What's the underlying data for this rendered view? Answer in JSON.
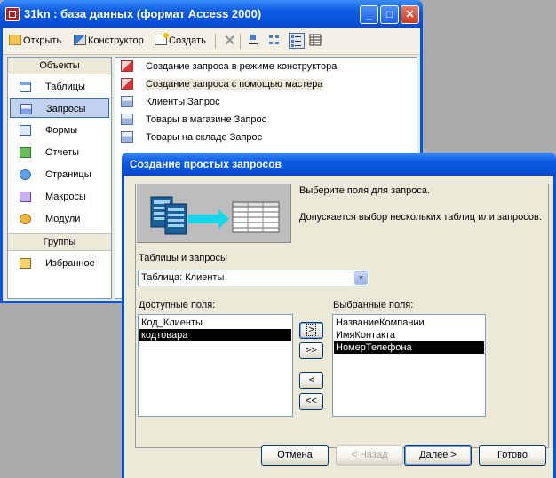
{
  "db_window": {
    "title": "31kn : база данных (формат Access 2000)",
    "title_buttons": {
      "minimize": "_",
      "maximize": "□",
      "close": "✕"
    },
    "toolbar": {
      "open": "Открыть",
      "design": "Конструктор",
      "new": "Создать",
      "delete_icon": "✕"
    },
    "objects_header": "Объекты",
    "objects": [
      {
        "label": "Таблицы",
        "icon": "table-icon"
      },
      {
        "label": "Запросы",
        "icon": "query-icon",
        "selected": true
      },
      {
        "label": "Формы",
        "icon": "form-icon"
      },
      {
        "label": "Отчеты",
        "icon": "report-icon"
      },
      {
        "label": "Страницы",
        "icon": "page-icon"
      },
      {
        "label": "Макросы",
        "icon": "macro-icon"
      },
      {
        "label": "Модули",
        "icon": "module-icon"
      }
    ],
    "groups_header": "Группы",
    "groups": [
      {
        "label": "Избранное",
        "icon": "favorites-icon"
      }
    ],
    "list_items": [
      {
        "label": "Создание запроса в режиме конструктора",
        "icon": "wizard-icon"
      },
      {
        "label": "Создание запроса с помощью мастера",
        "icon": "wizard-icon"
      },
      {
        "label": "Клиенты Запрос",
        "icon": "query-icon"
      },
      {
        "label": "Товары в магазине Запрос",
        "icon": "query-icon"
      },
      {
        "label": "Товары на складе Запрос",
        "icon": "query-icon"
      }
    ]
  },
  "dialog": {
    "title": "Создание простых запросов",
    "instruction": "Выберите поля для запроса.",
    "hint": "Допускается выбор нескольких таблиц или запросов.",
    "tables_label": "Таблицы и запросы",
    "combo_value": "Таблица: Клиенты",
    "available_label": "Доступные поля:",
    "available_fields": [
      "Код_Клиенты",
      "кодтовара"
    ],
    "available_selected_index": 1,
    "selected_label": "Выбранные поля:",
    "selected_fields": [
      "НазваниеКомпании",
      "ИмяКонтакта",
      "НомерТелефона"
    ],
    "selected_selected_index": 2,
    "move_buttons": {
      "add_one": ">",
      "add_all": ">>",
      "remove_one": "<",
      "remove_all": "<<"
    },
    "buttons": {
      "cancel": "Отмена",
      "back": "< Назад",
      "next": "Далее >",
      "finish": "Готово"
    }
  },
  "colors": {
    "title_blue": "#0054e3",
    "face": "#ece9d8",
    "selection": "#000000",
    "nav_selected": "#c1d2ee"
  }
}
